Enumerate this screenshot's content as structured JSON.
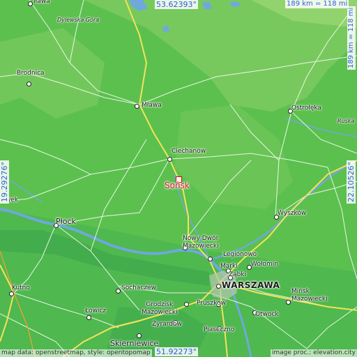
{
  "map": {
    "colors": {
      "lowland": "#5cc04f",
      "upland": "#9bd673",
      "valley": "#3fae52",
      "river": "#6fa8dc",
      "road_major": "#f2e35a",
      "road_minor": "#ffffff",
      "target": "#e8152d",
      "coord_text": "#2e5ed8"
    },
    "target": {
      "name": "Sońsk"
    },
    "coords": {
      "top_lat": "53.62393°",
      "bottom_lat": "51.92273°",
      "left_lon": "19.29276°",
      "right_lon": "22.10526°"
    },
    "scale": {
      "horizontal": "189 km = 118 mi",
      "vertical": "189 km = 118 mi"
    },
    "cities": {
      "ilawa": "Iława",
      "dylewska": "Dylewska Góra",
      "brodnica": "Brodnica",
      "mlawa": "Mława",
      "ostroleka": "Ostrołęka",
      "ruska": "Ruska",
      "ciechanow": "Ciechanów",
      "wek": "wek",
      "plock": "Płock",
      "wyszkow": "Wyszków",
      "nowy_dwor": "Nowy Dwór\nMazowiecki",
      "legionowo": "Legionowo",
      "marki": "Marki",
      "wolomin": "Wołomin",
      "zabki": "Ząbki",
      "kutno": "Kutno",
      "sochaczew": "Sochaczew",
      "warszawa": "WARSZAWA",
      "minsk": "Mińsk\nMazowiecki",
      "grodzisk": "Grodzisk\nMazowiecki",
      "pruszkow": "Pruszków",
      "lowicz": "Łowicz",
      "otwock": "Otwock",
      "zyrardow": "Żyrardów",
      "piaseczno": "Piaseczno",
      "skierniewice": "Skierniewice"
    },
    "credits": {
      "left": "map data: openstreetmap, style: opentopomap",
      "right": "image proc.: elevation.city"
    }
  }
}
